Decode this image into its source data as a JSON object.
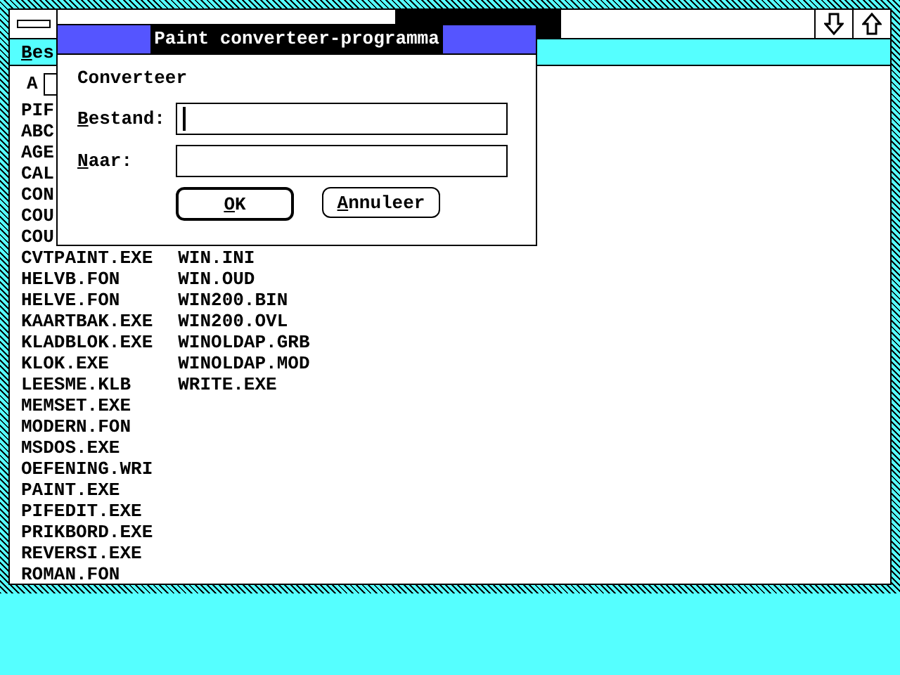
{
  "window": {
    "title_highlight": true
  },
  "menu_bar": {
    "items": [
      "Bes"
    ]
  },
  "drive_bar": {
    "drive": "A"
  },
  "file_list": {
    "path": "PIF",
    "column_1": [
      "ABC",
      "AGE",
      "CAL",
      "CON",
      "COU",
      "COU",
      "CVTPAINT.EXE",
      "HELVB.FON",
      "HELVE.FON",
      "KAARTBAK.EXE",
      "KLADBLOK.EXE",
      "KLOK.EXE",
      "LEESME.KLB",
      "MEMSET.EXE",
      "MODERN.FON",
      "MSDOS.EXE",
      "OEFENING.WRI",
      "PAINT.EXE",
      "PIFEDIT.EXE",
      "PRIKBORD.EXE",
      "REVERSI.EXE",
      "ROMAN.FON"
    ],
    "column_2": [
      "WIN.INI",
      "WIN.OUD",
      "WIN200.BIN",
      "WIN200.OVL",
      "WINOLDAP.GRB",
      "WINOLDAP.MOD",
      "WRITE.EXE"
    ]
  },
  "dialog": {
    "title": "Paint converteer-programma",
    "heading": "Converteer",
    "fields": [
      {
        "label": "Bestand:",
        "focused": true
      },
      {
        "label": "Naar:",
        "focused": false
      }
    ],
    "buttons": [
      {
        "label": "OK",
        "default": true
      },
      {
        "label": "Annuleer",
        "default": false
      }
    ]
  }
}
